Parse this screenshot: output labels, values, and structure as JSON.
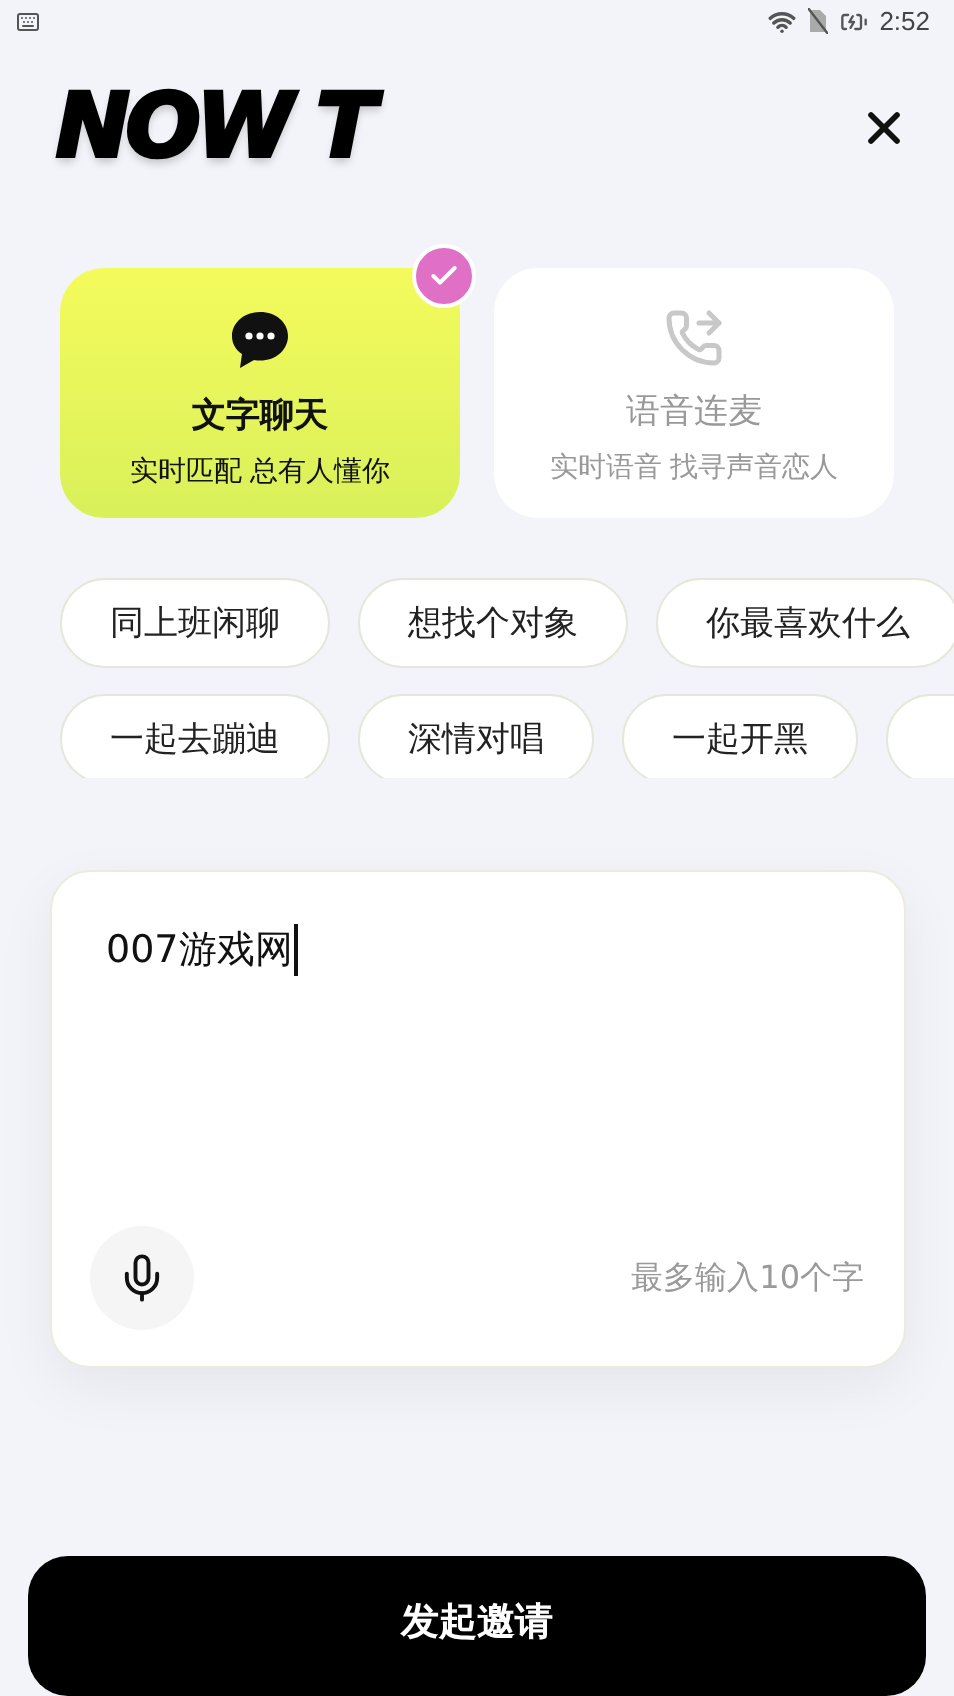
{
  "status_bar": {
    "time": "2:52"
  },
  "logo": "NOW T",
  "modes": [
    {
      "title": "文字聊天",
      "subtitle": "实时匹配 总有人懂你",
      "kind": "text",
      "selected": true
    },
    {
      "title": "语音连麦",
      "subtitle": "实时语音 找寻声音恋人",
      "kind": "voice",
      "selected": false
    }
  ],
  "topic_rows": [
    [
      "同上班闲聊",
      "想找个对象",
      "你最喜欢什么"
    ],
    [
      "一起去蹦迪",
      "深情对唱",
      "一起开黑",
      ""
    ]
  ],
  "input": {
    "value": "007游戏网",
    "counter": "最多输入10个字"
  },
  "submit_button": "发起邀请"
}
